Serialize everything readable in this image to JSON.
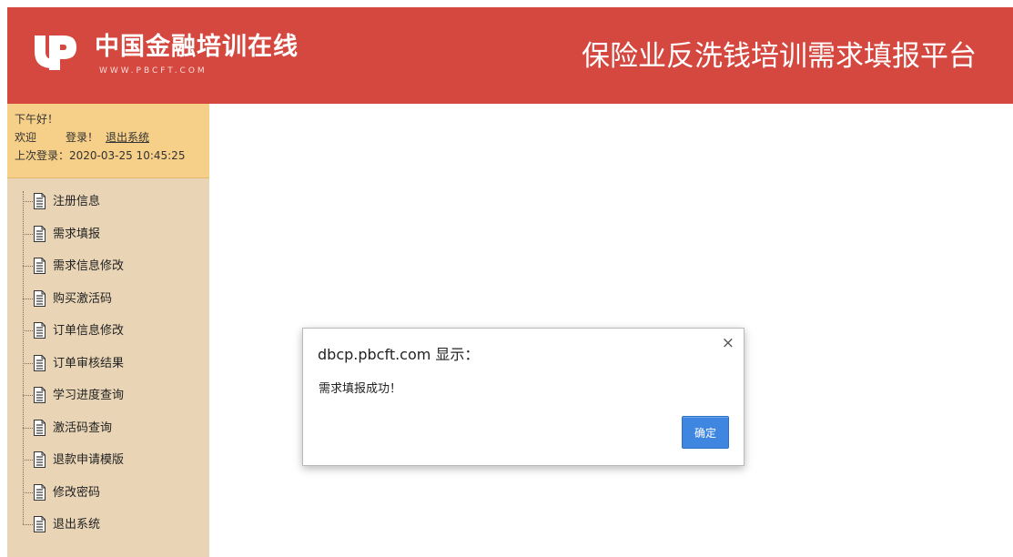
{
  "header": {
    "logo_name": "中国金融培训在线",
    "logo_url": "WWW.PBCFT.COM",
    "title": "保险业反洗钱培训需求填报平台"
  },
  "user_panel": {
    "greeting": "下午好！",
    "welcome": "欢迎",
    "logged_in": "登录！",
    "logout_link": "退出系统",
    "last_login": "上次登录：2020-03-25 10:45:25"
  },
  "nav": {
    "items": [
      {
        "label": "注册信息",
        "icon": "document-icon"
      },
      {
        "label": "需求填报",
        "icon": "document-icon"
      },
      {
        "label": "需求信息修改",
        "icon": "document-icon"
      },
      {
        "label": "购买激活码",
        "icon": "document-icon"
      },
      {
        "label": "订单信息修改",
        "icon": "document-icon"
      },
      {
        "label": "订单审核结果",
        "icon": "document-icon"
      },
      {
        "label": "学习进度查询",
        "icon": "document-icon"
      },
      {
        "label": "激活码查询",
        "icon": "document-icon"
      },
      {
        "label": "退款申请模版",
        "icon": "document-icon"
      },
      {
        "label": "修改密码",
        "icon": "document-icon"
      },
      {
        "label": "退出系统",
        "icon": "document-icon"
      }
    ]
  },
  "dialog": {
    "title": "dbcp.pbcft.com 显示：",
    "message": "需求填报成功！",
    "close_symbol": "×",
    "ok_label": "确定"
  },
  "colors": {
    "header_bg": "#d4483f",
    "sidebar_bg": "#e9d5b6",
    "greeting_bg": "#f6cf88",
    "button_bg": "#3f86e0"
  }
}
